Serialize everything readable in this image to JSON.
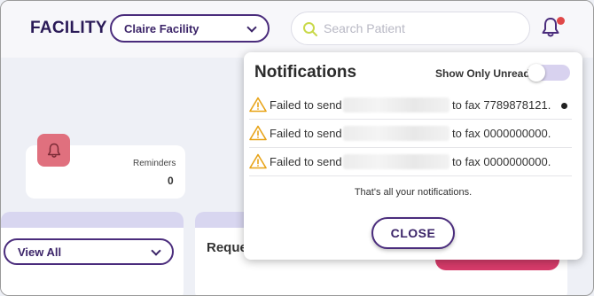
{
  "header": {
    "brand": "FACILITY",
    "facility_selected": "Claire Facility",
    "search": {
      "placeholder": "Search Patient",
      "value": ""
    },
    "bell_has_unread": true
  },
  "reminders": {
    "label": "Reminders",
    "count": "0"
  },
  "filter": {
    "selected": "View All"
  },
  "requests": {
    "title": "Reque"
  },
  "notifications": {
    "title": "Notifications",
    "show_only_unread_label": "Show Only Unread",
    "show_only_unread": false,
    "items": [
      {
        "prefix": "Failed to send",
        "suffix": "to fax 7789878121.",
        "unread": true
      },
      {
        "prefix": "Failed to send",
        "suffix": "to fax 0000000000.",
        "unread": false
      },
      {
        "prefix": "Failed to send",
        "suffix": "to fax 0000000000.",
        "unread": false
      }
    ],
    "end_message": "That's all your notifications.",
    "close_label": "CLOSE"
  },
  "colors": {
    "brand": "#2a1a57",
    "accent": "#4a2c7c",
    "warning": "#e8a317",
    "badge": "#e04848",
    "reminder_icon_bg": "#e0707e",
    "pink_button": "#d63b6a"
  }
}
